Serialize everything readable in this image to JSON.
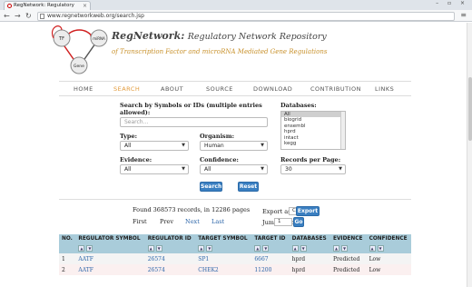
{
  "browser": {
    "tab_title": "RegNetwork: Regulatory",
    "url": "www.regnetworkweb.org/search.jsp"
  },
  "header": {
    "logo_nodes": [
      "TF",
      "miRNA",
      "Gene"
    ],
    "title_bold": "RegNetwork:",
    "title_rest": "Regulatory Network Repository",
    "subtitle": "of Transcription Factor and microRNA Mediated Gene Regulations"
  },
  "nav": [
    {
      "label": "HOME",
      "active": false
    },
    {
      "label": "SEARCH",
      "active": true
    },
    {
      "label": "ABOUT",
      "active": false
    },
    {
      "label": "SOURCE",
      "active": false
    },
    {
      "label": "DOWNLOAD",
      "active": false
    },
    {
      "label": "CONTRIBUTION",
      "active": false
    },
    {
      "label": "LINKS",
      "active": false
    }
  ],
  "form": {
    "search_label": "Search by Symbols or IDs (multiple entries allowed):",
    "search_placeholder": "Search...",
    "databases_label": "Databases:",
    "databases": [
      "All",
      "biogrid",
      "ensembl",
      "hprd",
      "intact",
      "kegg"
    ],
    "databases_selected": "All",
    "type_label": "Type:",
    "type_value": "All",
    "organism_label": "Organism:",
    "organism_value": "Human",
    "evidence_label": "Evidence:",
    "evidence_value": "All",
    "confidence_label": "Confidence:",
    "confidence_value": "All",
    "records_label": "Records per Page:",
    "records_value": "30",
    "search_button": "Search",
    "reset_button": "Reset"
  },
  "results": {
    "found_text": "Found 368573 records, in 12286 pages",
    "first": "First",
    "prev": "Prev",
    "next": "Next",
    "last": "Last",
    "export_label": "Export as:",
    "export_value": "CSV",
    "export_button": "Export",
    "jump_label": "Jump to page:",
    "jump_value": "1",
    "go_button": "Go"
  },
  "table": {
    "columns": [
      "NO.",
      "REGULATOR SYMBOL",
      "REGULATOR ID",
      "TARGET SYMBOL",
      "TARGET ID",
      "DATABASES",
      "EVIDENCE",
      "CONFIDENCE"
    ],
    "rows": [
      [
        "1",
        "AATF",
        "26574",
        "SP1",
        "6667",
        "hprd",
        "Predicted",
        "Low"
      ],
      [
        "2",
        "AATF",
        "26574",
        "CHEK2",
        "11200",
        "hprd",
        "Predicted",
        "Low"
      ]
    ]
  },
  "colors": {
    "accent_orange": "#e29a3a",
    "button_blue": "#3a7fc1",
    "table_header": "#a9ccda",
    "link_blue": "#2a64a8"
  }
}
